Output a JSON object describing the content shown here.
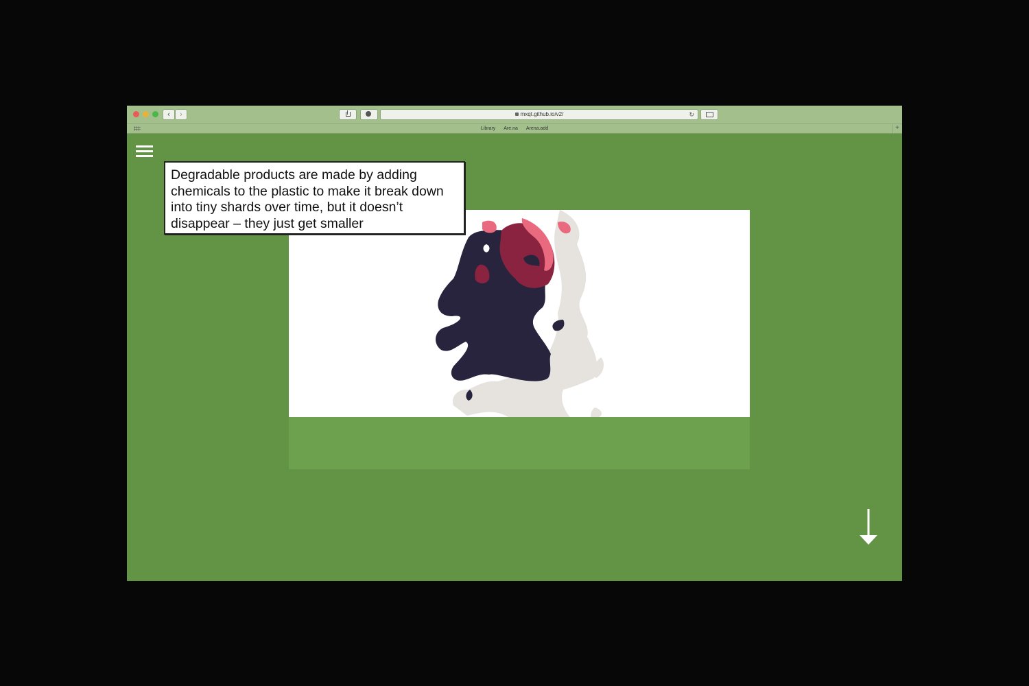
{
  "browser": {
    "url_text": "mxqt.github.io/v2/",
    "bookmarks": [
      "Library",
      "Are.na",
      "Arena.add"
    ]
  },
  "page": {
    "background_color": "#639446",
    "tooltip_text": "Degradable products are made by adding chemicals to the plastic to make it break down into tiny shards over time, but it doesn’t disappear – they just get smaller",
    "menu_icon": "hamburger-menu-icon",
    "scroll_icon": "arrow-down-icon"
  },
  "colors": {
    "blob_dark": "#29243e",
    "blob_light": "#e6e3df",
    "blob_red": "#8a2340",
    "blob_pink": "#e9697f"
  }
}
